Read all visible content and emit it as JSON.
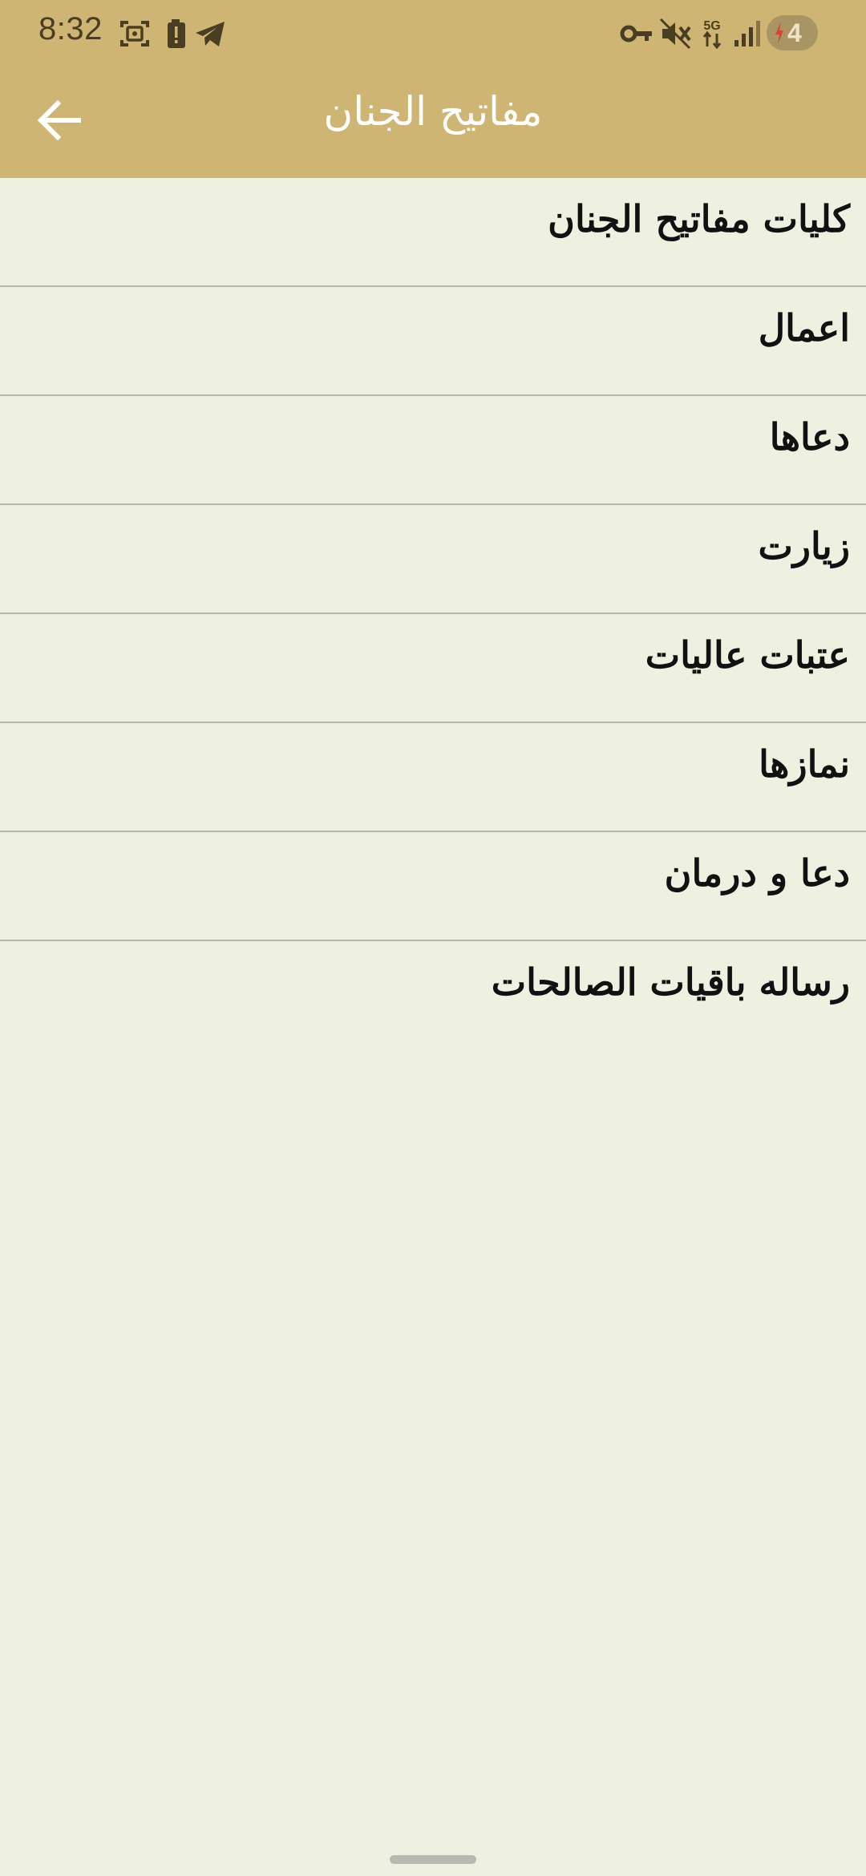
{
  "status_bar": {
    "time": "8:32",
    "battery_level": "4",
    "icons": [
      "screenshot-icon",
      "battery-alert-icon",
      "telegram-icon",
      "vpn-key-icon",
      "vibrate-off-icon",
      "5g-icon",
      "signal-icon",
      "charging-bolt-icon"
    ]
  },
  "header": {
    "title": "مفاتیح الجنان",
    "back_icon": "arrow-back-icon"
  },
  "menu": {
    "items": [
      {
        "label": "کلیات مفاتیح الجنان"
      },
      {
        "label": "اعمال"
      },
      {
        "label": "دعاها"
      },
      {
        "label": "زیارت"
      },
      {
        "label": "عتبات عالیات"
      },
      {
        "label": "نمازها"
      },
      {
        "label": "دعا و درمان"
      },
      {
        "label": "رساله باقیات الصالحات"
      }
    ]
  },
  "colors": {
    "header_background": "#ceb574",
    "page_background": "#eef1df",
    "divider": "#b8b8a8",
    "title_text": "#ffffff",
    "item_text": "#111111",
    "battery_pill": "#a89563",
    "charging_bolt": "#d9442f"
  }
}
